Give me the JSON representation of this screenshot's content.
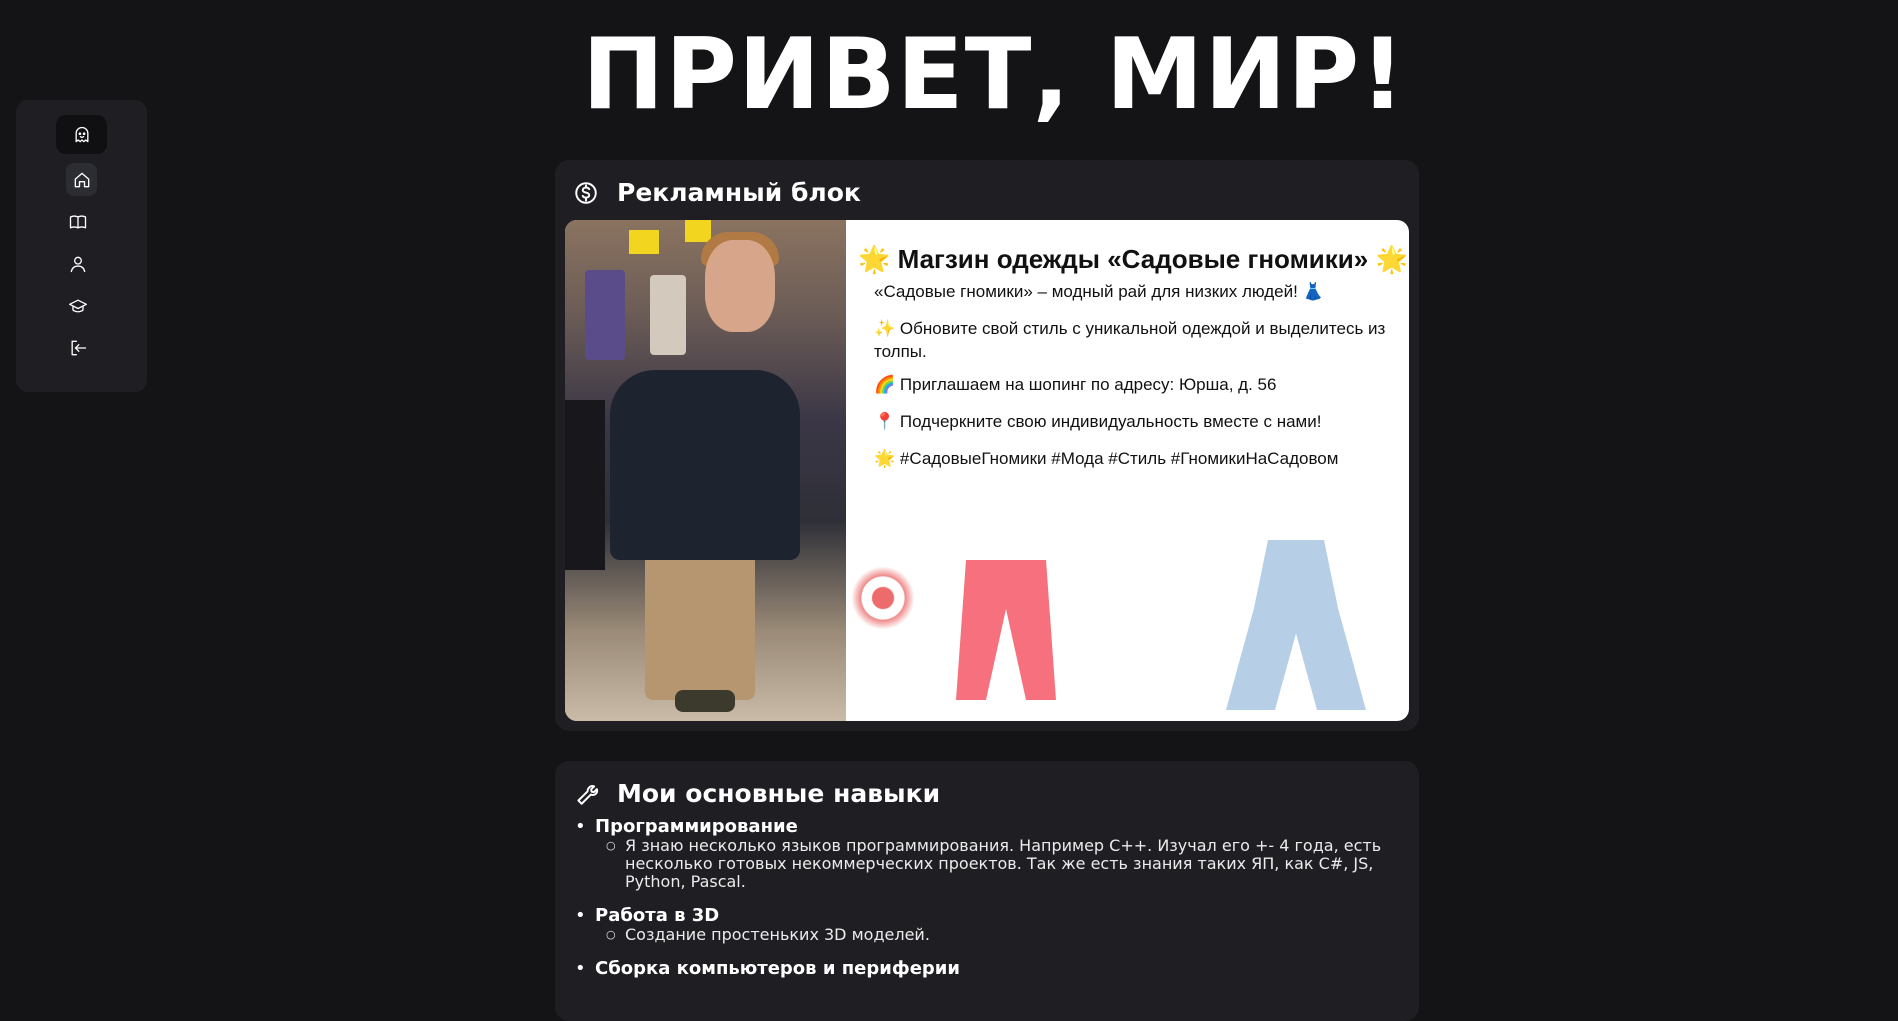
{
  "page": {
    "title": "ПРИВЕТ, МИР!"
  },
  "sidebar": {
    "items": [
      {
        "icon": "ghost-icon"
      },
      {
        "icon": "home-icon"
      },
      {
        "icon": "book-icon"
      },
      {
        "icon": "user-icon"
      },
      {
        "icon": "graduation-cap-icon"
      },
      {
        "icon": "logout-icon"
      }
    ]
  },
  "ad_block": {
    "title": "Рекламный блок",
    "icon": "dollar-circle-icon",
    "banner": {
      "heading": "🌟 Магзин одежды «Садовые гномики» 🌟",
      "lines": [
        "«Садовые гномики» – модный рай для низких людей! 👗",
        "✨ Обновите свой стиль с уникальной одеждой и выделитесь из толпы.",
        "🌈 Приглашаем на шопинг по адресу: Юрша, д. 56",
        "📍 Подчеркните свою индивидуальность вместе с нами!",
        "🌟 #СадовыеГномики #Мода #Стиль #ГномикиНаСадовом"
      ]
    }
  },
  "skills": {
    "title": "Мои основные навыки",
    "icon": "wrench-icon",
    "items": [
      {
        "name": "Программирование",
        "desc": "Я знаю несколько языков программирования. Например C++. Изучал его +- 4 года, есть несколько готовых некоммерческих проектов. Так же есть знания таких ЯП, как C#, JS, Python, Pascal."
      },
      {
        "name": "Работа в 3D",
        "desc": "Создание простеньких 3D моделей."
      },
      {
        "name": "Сборка компьютеров и периферии",
        "desc": ""
      }
    ]
  },
  "colors": {
    "background": "#141417",
    "card": "#1e1e23",
    "text": "#ffffff"
  }
}
